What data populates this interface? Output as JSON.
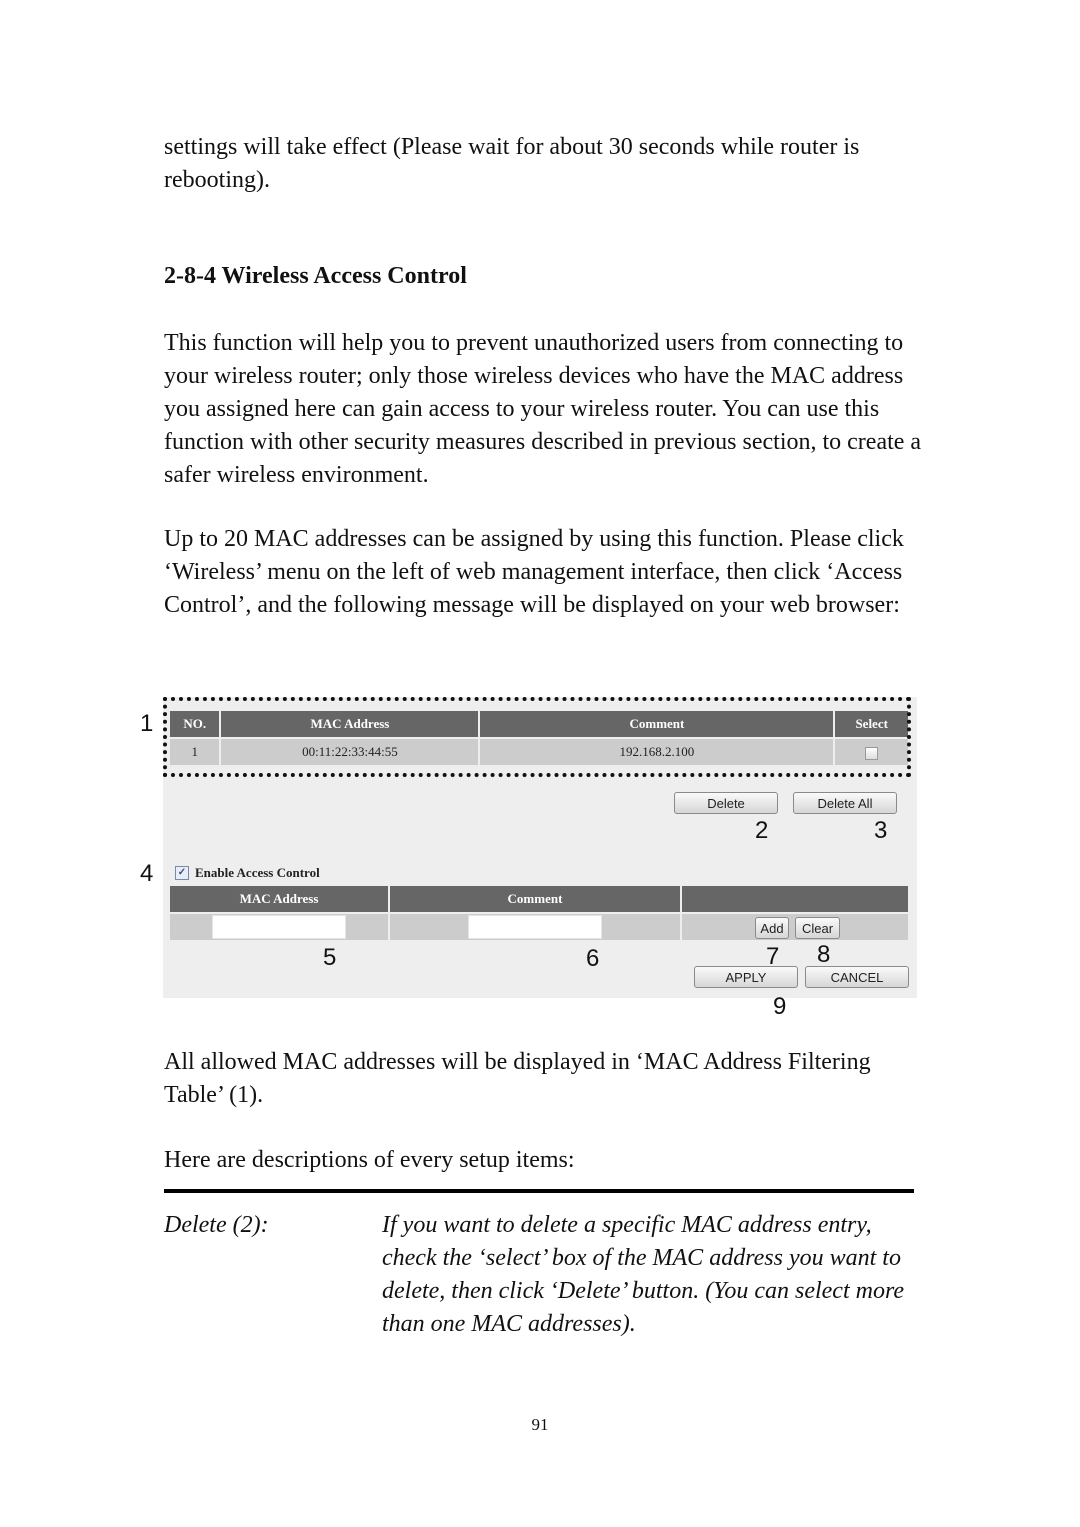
{
  "text": {
    "intro": "settings will take effect (Please wait for about 30 seconds while router is rebooting).",
    "heading": "2-8-4 Wireless Access Control",
    "para1": "This function will help you to prevent unauthorized users from connecting to your wireless router; only those wireless devices who have the MAC address you assigned here can gain access to your wireless router. You can use this function with other security measures described in previous section, to create a safer wireless environment.",
    "para2": "Up to 20 MAC addresses can be assigned by using this function. Please click ‘Wireless’ menu on the left of web management interface, then click ‘Access Control’, and the following message will be displayed on your web browser:",
    "para3": "All allowed MAC addresses will be displayed in ‘MAC Address Filtering Table’ (1).",
    "para4": "Here are descriptions of every setup items:",
    "term": "Delete (2):",
    "desc": "If you want to delete a specific MAC address entry, check the ‘select’ box of the MAC address you want to delete, then click ‘Delete’ button. (You can select more than one MAC addresses).",
    "page_number": "91"
  },
  "ui": {
    "filter_table": {
      "headers": [
        "NO.",
        "MAC Address",
        "Comment",
        "Select"
      ],
      "rows": [
        {
          "no": "1",
          "mac": "00:11:22:33:44:55",
          "comment": "192.168.2.100",
          "selected": false
        }
      ]
    },
    "delete_label": "Delete",
    "delete_all_label": "Delete All",
    "enable_label": "Enable Access Control",
    "enable_checked": true,
    "add_table": {
      "headers": [
        "MAC Address",
        "Comment",
        ""
      ]
    },
    "mac_input_value": "",
    "comment_input_value": "",
    "add_label": "Add",
    "clear_label": "Clear",
    "apply_label": "APPLY",
    "cancel_label": "CANCEL",
    "callouts": [
      "1",
      "2",
      "3",
      "4",
      "5",
      "6",
      "7",
      "8",
      "9"
    ]
  }
}
